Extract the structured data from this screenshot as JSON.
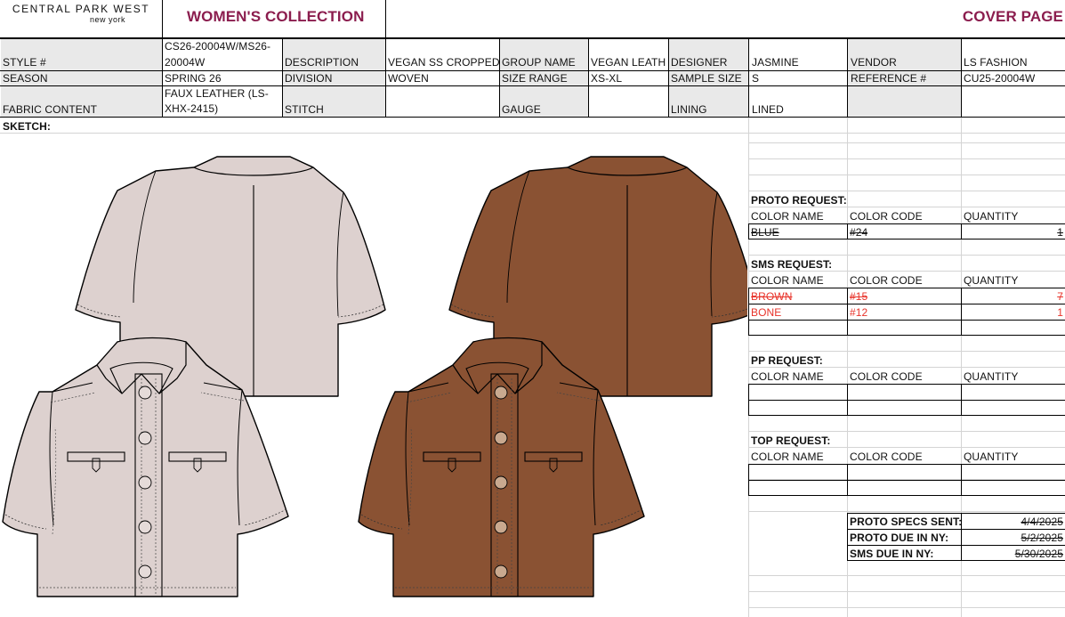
{
  "brand": {
    "name": "CENTRAL PARK WEST",
    "city": "new york"
  },
  "header": {
    "collection": "WOMEN'S COLLECTION",
    "page": "COVER PAGE"
  },
  "specs": {
    "style_label": "STYLE #",
    "style_value_1": "CS26-20004W/MS26-",
    "style_value_2": "20004W",
    "description_label": "DESCRIPTION",
    "description_value": "VEGAN SS CROPPED",
    "group_label": "GROUP NAME",
    "group_value": "VEGAN LEATH",
    "designer_label": "DESIGNER",
    "designer_value": "JASMINE",
    "vendor_label": "VENDOR",
    "vendor_value": "LS FASHION",
    "season_label": "SEASON",
    "season_value": "SPRING 26",
    "division_label": "DIVISION",
    "division_value": "WOVEN",
    "size_label": "SIZE RANGE",
    "size_value": "XS-XL",
    "sample_label": "SAMPLE SIZE",
    "sample_value": "S",
    "reference_label": "REFERENCE #",
    "reference_value": "CU25-20004W",
    "fabric_label": "FABRIC CONTENT",
    "fabric_value_1": "FAUX LEATHER (LS-",
    "fabric_value_2": "XHX-2415)",
    "stitch_label": "STITCH",
    "gauge_label": "GAUGE",
    "lining_label": "LINING",
    "lining_value": "LINED"
  },
  "sketch_label": "SKETCH:",
  "requests": {
    "col_name": "COLOR NAME",
    "col_code": "COLOR CODE",
    "col_qty": "QUANTITY",
    "proto": {
      "title": "PROTO REQUEST:",
      "rows": [
        {
          "name": "BLUE",
          "code": "#24",
          "qty": "1"
        }
      ]
    },
    "sms": {
      "title": "SMS REQUEST:",
      "rows": [
        {
          "name": "BROWN",
          "code": "#15",
          "qty": "7"
        },
        {
          "name": "BONE",
          "code": "#12",
          "qty": "1"
        }
      ]
    },
    "pp": {
      "title": "PP REQUEST:"
    },
    "top": {
      "title": "TOP REQUEST:"
    }
  },
  "dates": {
    "proto_sent_label": "PROTO SPECS SENT:",
    "proto_sent": "4/4/2025",
    "proto_due_label": "PROTO DUE IN NY:",
    "proto_due": "5/2/2025",
    "sms_due_label": "SMS DUE IN NY:",
    "sms_due": "5/30/2025"
  },
  "colors": {
    "title": "#8b1d4e",
    "bone": "#ddd1cf",
    "brown": "#8a5233",
    "red": "#e8332a"
  }
}
